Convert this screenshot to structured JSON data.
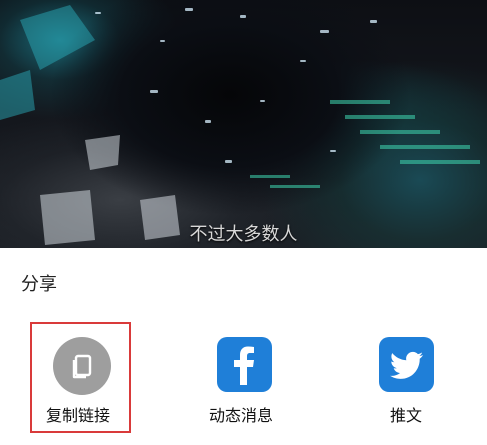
{
  "video": {
    "subtitle": "不过大多数人"
  },
  "share_sheet": {
    "title": "分享",
    "options": [
      {
        "label": "复制链接",
        "icon": "copy-icon",
        "color": "#9e9e9e"
      },
      {
        "label": "动态消息",
        "icon": "facebook-icon",
        "color": "#1f7fd8"
      },
      {
        "label": "推文",
        "icon": "twitter-bird-icon",
        "color": "#1f7fd8"
      }
    ],
    "highlight_color": "#d93a3a"
  }
}
